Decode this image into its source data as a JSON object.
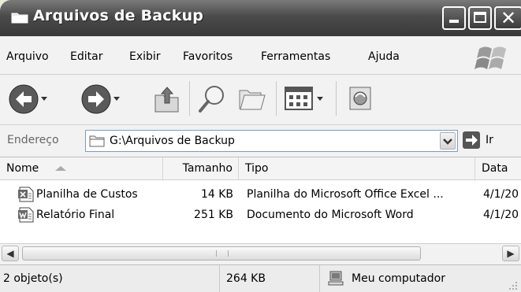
{
  "window": {
    "title": "Arquivos de Backup",
    "icon": "folder-icon",
    "buttons": [
      "minimize-icon",
      "maximize-icon",
      "close-icon"
    ]
  },
  "menu": {
    "items": [
      {
        "label": "Arquivo"
      },
      {
        "label": "Editar"
      },
      {
        "label": "Exibir"
      },
      {
        "label": "Favoritos"
      },
      {
        "label": "Ferramentas"
      },
      {
        "label": "Ajuda"
      }
    ]
  },
  "toolbar": {
    "buttons": [
      "back-icon",
      "forward-icon",
      "up-folder-icon",
      "search-icon",
      "folders-icon",
      "views-icon",
      "sync-icon"
    ]
  },
  "address": {
    "label": "Endereço",
    "value": "G:\\Arquivos de Backup",
    "go_label": "Ir"
  },
  "columns": {
    "name": "Nome",
    "size": "Tamanho",
    "type": "Tipo",
    "date": "Data"
  },
  "files": [
    {
      "name": "Planilha de Custos",
      "size": "14 KB",
      "type": "Planilha do Microsoft Office Excel ...",
      "date": "4/1/20",
      "icon": "excel-file-icon"
    },
    {
      "name": "Relatório Final",
      "size": "251 KB",
      "type": "Documento do Microsoft Word",
      "date": "4/1/20",
      "icon": "word-file-icon"
    }
  ],
  "status": {
    "objects": "2 objeto(s)",
    "size": "264 KB",
    "location": "Meu computador"
  }
}
